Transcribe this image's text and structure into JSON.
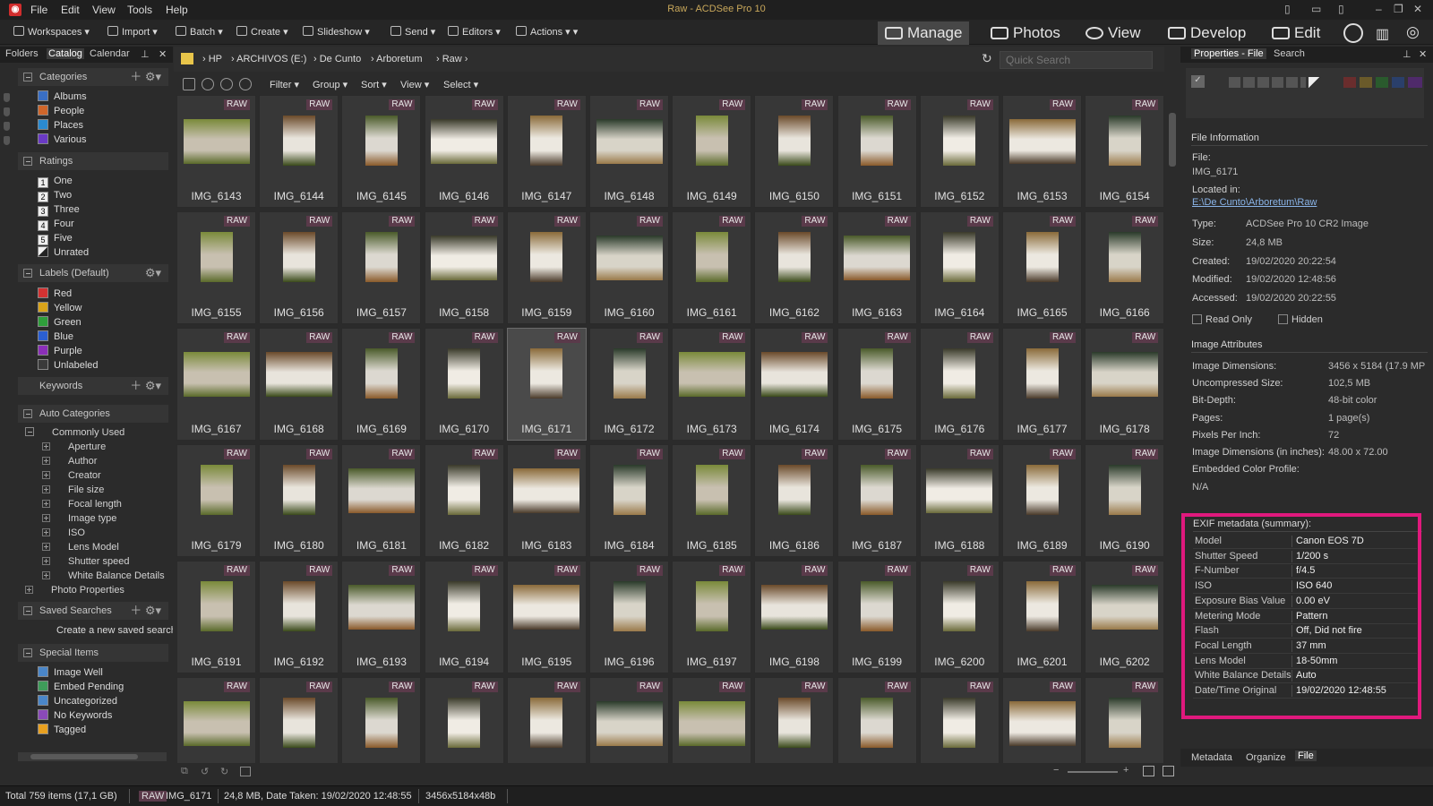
{
  "app": {
    "window_title": "Raw - ACDSee Pro 10",
    "menu": [
      "File",
      "Edit",
      "View",
      "Tools",
      "Help"
    ]
  },
  "toolbar": {
    "items": [
      "Workspaces",
      "Import",
      "Batch",
      "Create",
      "Slideshow",
      "Send",
      "Editors",
      "Actions"
    ],
    "modes": [
      "Manage",
      "Photos",
      "View",
      "Develop",
      "Edit"
    ],
    "active_mode": "Manage"
  },
  "left_panel": {
    "tabs": [
      "Folders",
      "Catalog",
      "Calendar"
    ],
    "active_tab": "Catalog",
    "categories": {
      "title": "Categories",
      "items": [
        "Albums",
        "People",
        "Places",
        "Various"
      ]
    },
    "ratings": {
      "title": "Ratings",
      "items": [
        {
          "num": "1",
          "label": "One"
        },
        {
          "num": "2",
          "label": "Two"
        },
        {
          "num": "3",
          "label": "Three"
        },
        {
          "num": "4",
          "label": "Four"
        },
        {
          "num": "5",
          "label": "Five"
        },
        {
          "num": "",
          "label": "Unrated"
        }
      ]
    },
    "labels": {
      "title": "Labels (Default)",
      "items": [
        {
          "label": "Red",
          "color": "#d23232"
        },
        {
          "label": "Yellow",
          "color": "#d9a31a"
        },
        {
          "label": "Green",
          "color": "#2f9e3b"
        },
        {
          "label": "Blue",
          "color": "#2b5fd1"
        },
        {
          "label": "Purple",
          "color": "#8b2fb8"
        },
        {
          "label": "Unlabeled",
          "color": "#3a3a3a"
        }
      ]
    },
    "keywords": {
      "title": "Keywords"
    },
    "auto_categories": {
      "title": "Auto Categories",
      "group": "Commonly Used",
      "items": [
        "Aperture",
        "Author",
        "Creator",
        "File size",
        "Focal length",
        "Image type",
        "ISO",
        "Lens Model",
        "Shutter speed",
        "White Balance Details"
      ],
      "extra": "Photo Properties"
    },
    "saved_searches": {
      "title": "Saved Searches",
      "item": "Create a new saved search"
    },
    "special_items": {
      "title": "Special Items",
      "items": [
        "Image Well",
        "Embed Pending",
        "Uncategorized",
        "No Keywords",
        "Tagged"
      ]
    }
  },
  "path": {
    "crumbs": [
      "HP",
      "ARCHIVOS (E:)",
      "De Cunto",
      "Arboretum",
      "Raw"
    ],
    "search_placeholder": "Quick Search"
  },
  "filter_bar": [
    "Filter",
    "Group",
    "Sort",
    "View",
    "Select"
  ],
  "grid": {
    "badge": "RAW",
    "selected": "IMG_6171",
    "files": [
      "IMG_6143",
      "IMG_6144",
      "IMG_6145",
      "IMG_6146",
      "IMG_6147",
      "IMG_6148",
      "IMG_6149",
      "IMG_6150",
      "IMG_6151",
      "IMG_6152",
      "IMG_6153",
      "IMG_6154",
      "IMG_6155",
      "IMG_6156",
      "IMG_6157",
      "IMG_6158",
      "IMG_6159",
      "IMG_6160",
      "IMG_6161",
      "IMG_6162",
      "IMG_6163",
      "IMG_6164",
      "IMG_6165",
      "IMG_6166",
      "IMG_6167",
      "IMG_6168",
      "IMG_6169",
      "IMG_6170",
      "IMG_6171",
      "IMG_6172",
      "IMG_6173",
      "IMG_6174",
      "IMG_6175",
      "IMG_6176",
      "IMG_6177",
      "IMG_6178",
      "IMG_6179",
      "IMG_6180",
      "IMG_6181",
      "IMG_6182",
      "IMG_6183",
      "IMG_6184",
      "IMG_6185",
      "IMG_6186",
      "IMG_6187",
      "IMG_6188",
      "IMG_6189",
      "IMG_6190",
      "IMG_6191",
      "IMG_6192",
      "IMG_6193",
      "IMG_6194",
      "IMG_6195",
      "IMG_6196",
      "IMG_6197",
      "IMG_6198",
      "IMG_6199",
      "IMG_6200",
      "IMG_6201",
      "IMG_6202",
      "",
      "",
      "",
      "",
      "",
      "",
      "",
      "",
      "",
      "",
      "",
      ""
    ]
  },
  "right_panel": {
    "tabs": [
      "Properties - File",
      "Search"
    ],
    "file_info": {
      "title": "File Information",
      "file_label": "File:",
      "file": "IMG_6171",
      "located_label": "Located in:",
      "located": "E:\\De Cunto\\Arboretum\\Raw",
      "rows": [
        {
          "k": "Type:",
          "v": "ACDSee Pro 10 CR2 Image"
        },
        {
          "k": "Size:",
          "v": "24,8 MB"
        },
        {
          "k": "Created:",
          "v": "19/02/2020 20:22:54"
        },
        {
          "k": "Modified:",
          "v": "19/02/2020 12:48:56"
        },
        {
          "k": "Accessed:",
          "v": "19/02/2020 20:22:55"
        }
      ],
      "read_only": "Read Only",
      "hidden": "Hidden"
    },
    "image_attributes": {
      "title": "Image Attributes",
      "rows": [
        {
          "k": "Image Dimensions:",
          "v": "3456 x 5184 (17.9 MP"
        },
        {
          "k": "Uncompressed Size:",
          "v": "102,5 MB"
        },
        {
          "k": "Bit-Depth:",
          "v": "48-bit color"
        },
        {
          "k": "Pages:",
          "v": "1 page(s)"
        },
        {
          "k": "Pixels Per Inch:",
          "v": "72"
        },
        {
          "k": "Image Dimensions (in inches):",
          "v": "48.00 x 72.00"
        },
        {
          "k": "Embedded Color Profile:",
          "v": ""
        }
      ],
      "na": "N/A"
    },
    "exif": {
      "title": "EXIF metadata (summary):",
      "rows": [
        {
          "k": "Model",
          "v": "Canon EOS 7D"
        },
        {
          "k": "Shutter Speed",
          "v": "1/200 s"
        },
        {
          "k": "F-Number",
          "v": "f/4.5"
        },
        {
          "k": "ISO",
          "v": "ISO 640"
        },
        {
          "k": "Exposure Bias Value",
          "v": "0.00 eV"
        },
        {
          "k": "Metering Mode",
          "v": "Pattern"
        },
        {
          "k": "Flash",
          "v": "Off, Did not fire"
        },
        {
          "k": "Focal Length",
          "v": "37 mm"
        },
        {
          "k": "Lens Model",
          "v": "18-50mm"
        },
        {
          "k": "White Balance Details",
          "v": "Auto"
        },
        {
          "k": "Date/Time Original",
          "v": "19/02/2020 12:48:55"
        }
      ]
    },
    "bottom_tabs": [
      "Metadata",
      "Organize",
      "File"
    ]
  },
  "status": {
    "total": "Total 759 items  (17,1 GB)",
    "badge": "RAW",
    "file": "IMG_6171",
    "info": "24,8 MB, Date Taken: 19/02/2020 12:48:55",
    "dims": "3456x5184x48b"
  },
  "colors": {
    "highlight": "#e0197d",
    "raw_badge": "#5a3a4a"
  }
}
